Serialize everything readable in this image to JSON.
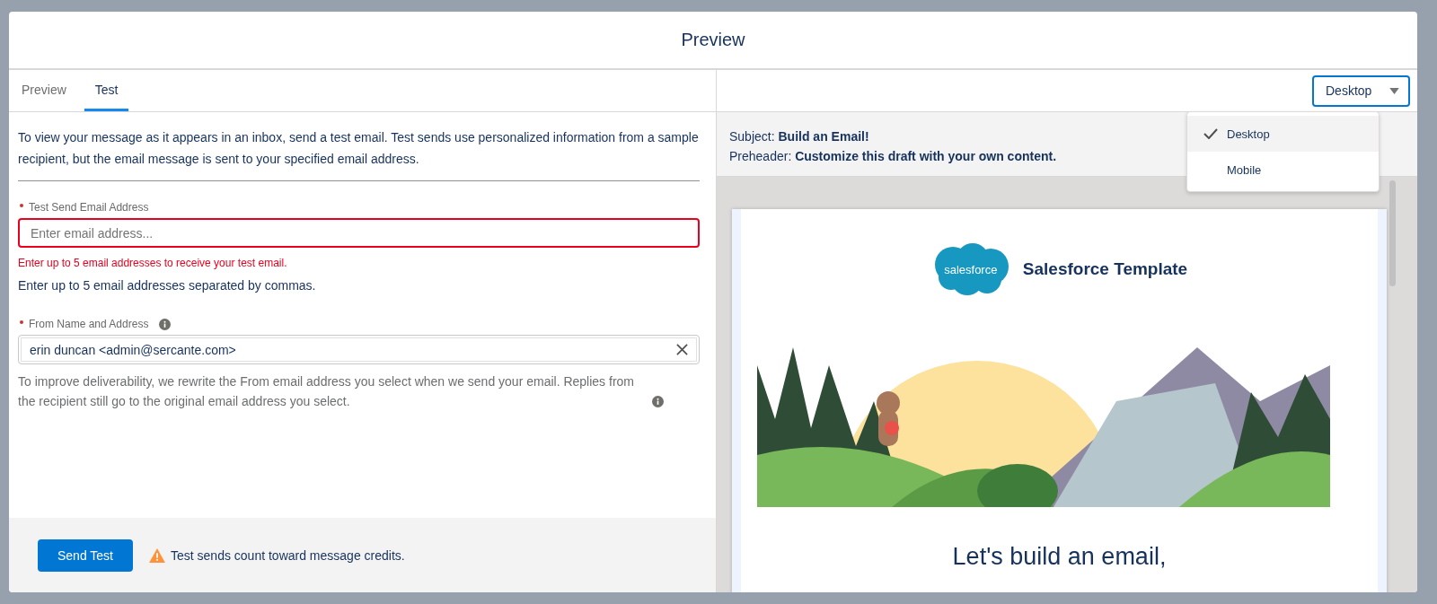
{
  "modal": {
    "title": "Preview"
  },
  "tabs": [
    {
      "label": "Preview",
      "selected": false
    },
    {
      "label": "Test",
      "selected": true
    }
  ],
  "intro": "To view your message as it appears in an inbox, send a test email. Test sends use personalized information from a sample recipient, but the email message is sent to your specified email address.",
  "fields": [
    {
      "label": "Test Send Email Address",
      "required": true,
      "placeholder": "Enter email address...",
      "invalid": true,
      "error": "Enter up to 5 email addresses to receive your test email.",
      "help": "Enter up to 5 email addresses separated by commas."
    },
    {
      "label": "From Name and Address",
      "required": true,
      "label_info": true,
      "value": "erin duncan <admin@sercante.com>",
      "clearable": true,
      "invalid": false,
      "note": "To improve deliverability, we rewrite the From email address you select when we send your email. Replies from the recipient still go to the original email address you select.",
      "note_info": true
    }
  ],
  "footer": {
    "button": "Send Test",
    "warning": "Test sends count toward message credits."
  },
  "view_select": {
    "value": "Desktop",
    "expanded": true,
    "options": [
      {
        "label": "Desktop",
        "selected": true
      },
      {
        "label": "Mobile",
        "selected": false
      }
    ]
  },
  "email": {
    "subject_label": "Subject:",
    "subject": "Build an Email!",
    "preheader_label": "Preheader:",
    "preheader": "Customize this draft with your own content.",
    "logo_text": "salesforce",
    "brand": "Salesforce Template",
    "headline": "Let's build an email,"
  }
}
